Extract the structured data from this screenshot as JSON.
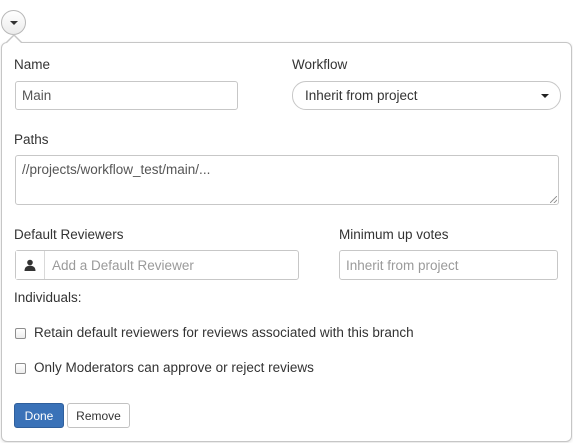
{
  "toggle": {
    "icon": "caret-down-icon"
  },
  "form": {
    "name": {
      "label": "Name",
      "value": "Main"
    },
    "workflow": {
      "label": "Workflow",
      "selected": "Inherit from project",
      "icon": "caret-down-icon"
    },
    "paths": {
      "label": "Paths",
      "value": "//projects/workflow_test/main/..."
    },
    "default_reviewers": {
      "label": "Default Reviewers",
      "placeholder": "Add a Default Reviewer",
      "icon": "user-icon"
    },
    "minimum_up_votes": {
      "label": "Minimum up votes",
      "placeholder": "Inherit from project"
    },
    "individuals_label": "Individuals:",
    "checkboxes": [
      {
        "label": "Retain default reviewers for reviews associated with this branch",
        "checked": false
      },
      {
        "label": "Only Moderators can approve or reject reviews",
        "checked": false
      }
    ]
  },
  "actions": {
    "done": "Done",
    "remove": "Remove"
  },
  "colors": {
    "primary": "#3a72b8",
    "border": "#c7c7c7"
  }
}
